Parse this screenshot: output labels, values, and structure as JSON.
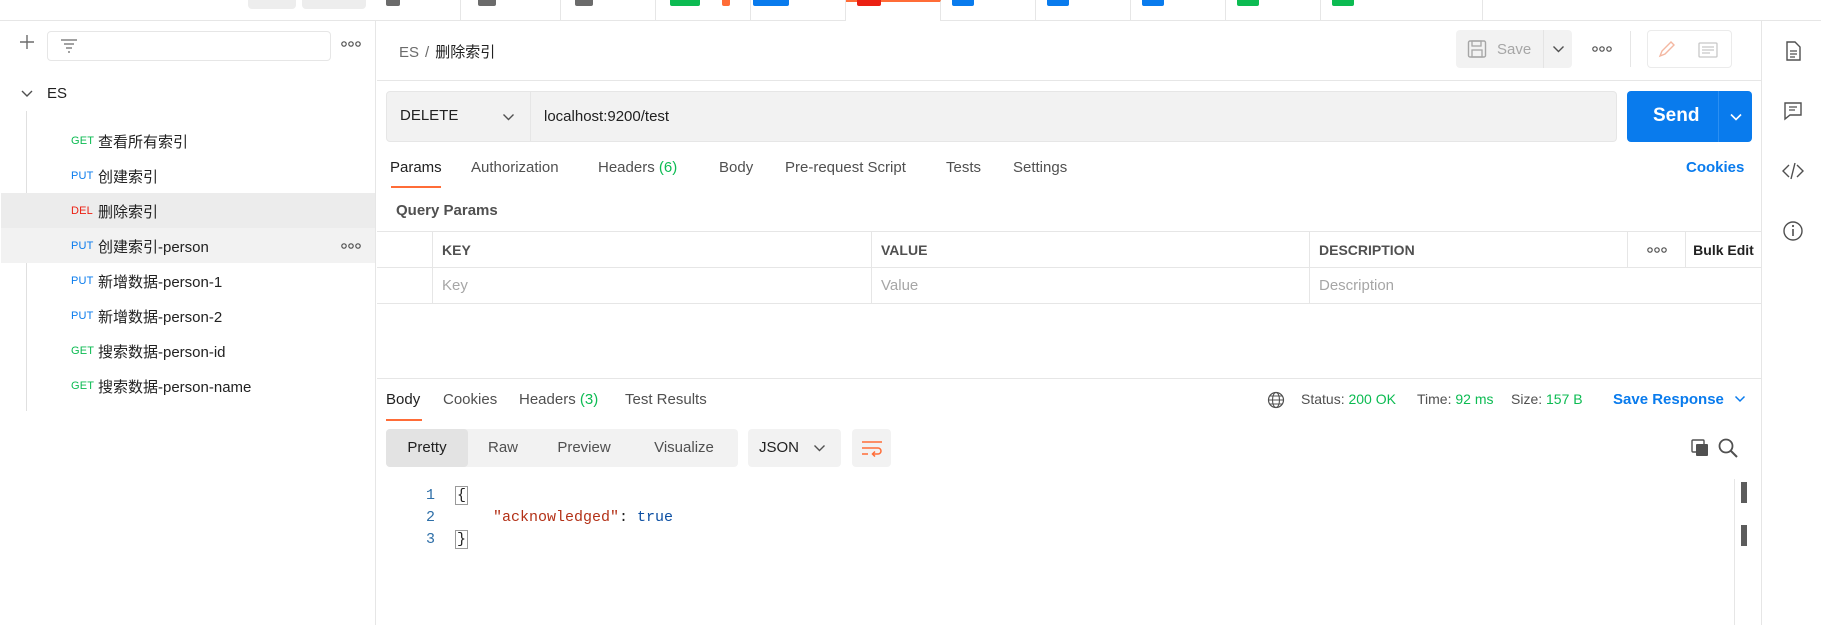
{
  "sidebar": {
    "collection_name": "ES",
    "requests": [
      {
        "method": "GET",
        "name": "查看所有索引"
      },
      {
        "method": "PUT",
        "name": "创建索引"
      },
      {
        "method": "DEL",
        "name": "删除索引"
      },
      {
        "method": "PUT",
        "name": "创建索引-person"
      },
      {
        "method": "PUT",
        "name": "新增数据-person-1"
      },
      {
        "method": "PUT",
        "name": "新增数据-person-2"
      },
      {
        "method": "GET",
        "name": "搜索数据-person-id"
      },
      {
        "method": "GET",
        "name": "搜索数据-person-name"
      }
    ]
  },
  "header": {
    "workspace": "ES",
    "separator": "/",
    "request_name": "删除索引",
    "save_label": "Save"
  },
  "request": {
    "method": "DELETE",
    "url": "localhost:9200/test",
    "send_label": "Send",
    "tabs": {
      "params": "Params",
      "authorization": "Authorization",
      "headers": "Headers",
      "headers_count": "(6)",
      "body": "Body",
      "prerequest": "Pre-request Script",
      "tests": "Tests",
      "settings": "Settings"
    },
    "cookies_label": "Cookies",
    "query_params_title": "Query Params",
    "table": {
      "headers": {
        "key": "KEY",
        "value": "VALUE",
        "description": "DESCRIPTION"
      },
      "placeholders": {
        "key": "Key",
        "value": "Value",
        "description": "Description"
      },
      "bulk_edit": "Bulk Edit"
    }
  },
  "response": {
    "tabs": {
      "body": "Body",
      "cookies": "Cookies",
      "headers": "Headers",
      "headers_count": "(3)",
      "test_results": "Test Results"
    },
    "status_label": "Status:",
    "status_value": "200 OK",
    "time_label": "Time:",
    "time_value": "92 ms",
    "size_label": "Size:",
    "size_value": "157 B",
    "save_response": "Save Response",
    "views": {
      "pretty": "Pretty",
      "raw": "Raw",
      "preview": "Preview",
      "visualize": "Visualize"
    },
    "format": "JSON",
    "lines": [
      "1",
      "2",
      "3"
    ],
    "code": {
      "open": "{",
      "key": "\"acknowledged\"",
      "colon": ": ",
      "value": "true",
      "close": "}"
    }
  },
  "colors": {
    "accent": "#ff6c37",
    "primary": "#097bed",
    "success": "#0cbb52",
    "danger": "#eb2013"
  },
  "icons": [
    "plus-icon",
    "filter-icon",
    "more-icon",
    "chevron-down-icon",
    "save-icon",
    "pencil-icon",
    "document-icon",
    "globe-icon",
    "wrap-icon",
    "copy-icon",
    "search-icon",
    "comment-icon",
    "code-icon",
    "info-icon"
  ]
}
